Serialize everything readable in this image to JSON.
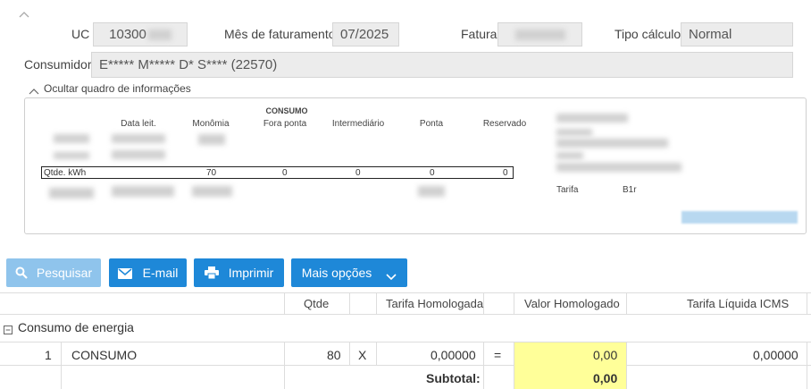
{
  "form": {
    "uc_label": "UC",
    "uc_value": "10300",
    "mes_label": "Mês de faturamento",
    "mes_value": "07/2025",
    "fatura_label": "Fatura",
    "tipo_label": "Tipo cálculo",
    "tipo_value": "Normal",
    "consumidor_label": "Consumidor",
    "consumidor_value": "E***** M***** D* S**** (22570)"
  },
  "info": {
    "toggle_label": "Ocultar quadro de informações",
    "group_header": "CONSUMO",
    "columns": [
      "Data leit.",
      "Monômia",
      "Fora ponta",
      "Intermediário",
      "Ponta",
      "Reservado"
    ],
    "qtde_label": "Qtde. kWh",
    "qtde_values": [
      "70",
      "0",
      "0",
      "0",
      "0"
    ],
    "tarifa_label": "Tarifa",
    "tarifa_value": "B1r"
  },
  "toolbar": {
    "pesquisar": "Pesquisar",
    "email": "E-mail",
    "imprimir": "Imprimir",
    "mais_opcoes": "Mais opções"
  },
  "table": {
    "headers": [
      "Qtde",
      "Tarifa Homologada",
      "Valor Homologado",
      "Tarifa Líquida ICMS"
    ],
    "group": "Consumo de energia",
    "row": {
      "index": "1",
      "name": "CONSUMO",
      "qtde": "80",
      "op": "X",
      "tarifa": "0,00000",
      "eq": "=",
      "valor": "0,00",
      "liquida": "0,00000"
    },
    "subtotal_label": "Subtotal:",
    "subtotal_value": "0,00"
  },
  "colors": {
    "accent": "#1e88d8",
    "disabled": "#8fc4ec",
    "highlight": "#ffff99"
  }
}
